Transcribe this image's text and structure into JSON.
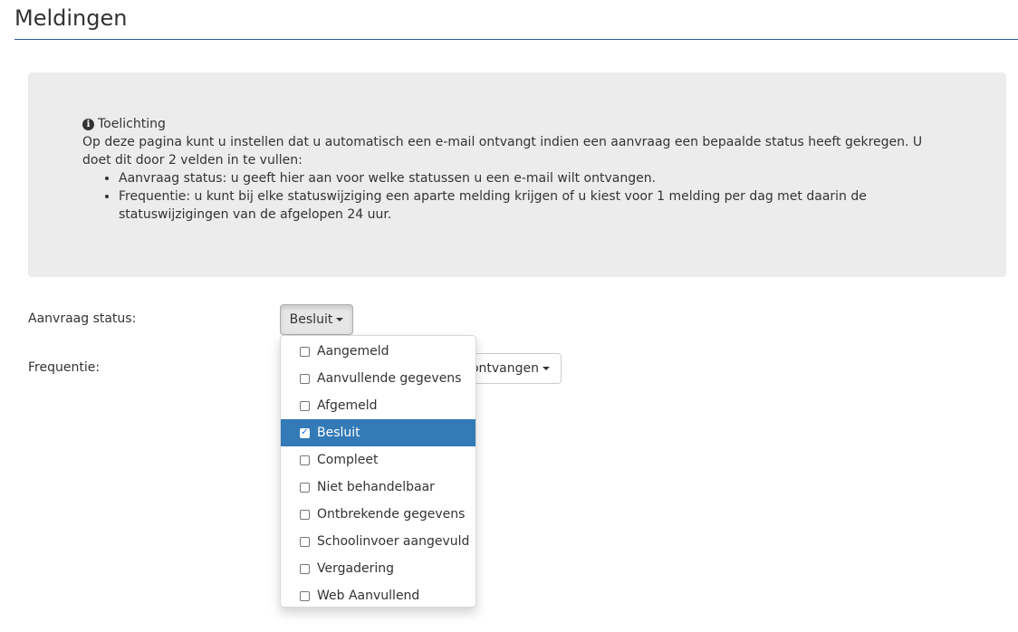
{
  "page": {
    "title": "Meldingen"
  },
  "info": {
    "heading": "Toelichting",
    "text": "Op deze pagina kunt u instellen dat u automatisch een e-mail ontvangt indien een aanvraag een bepaalde status heeft gekregen. U doet dit door 2 velden in te vullen:",
    "items": [
      "Aanvraag status: u geeft hier aan voor welke statussen u een e-mail wilt ontvangen.",
      "Frequentie: u kunt bij elke statuswijziging een aparte melding krijgen of u kiest voor 1 melding per dag met daarin de statuswijzigingen van de afgelopen 24 uur."
    ]
  },
  "form": {
    "status_label": "Aanvraag status:",
    "status_value": "Besluit",
    "frequency_label": "Frequentie:",
    "frequency_value_visible": "ontvangen"
  },
  "dropdown": {
    "options": [
      {
        "label": "Aangemeld",
        "checked": false
      },
      {
        "label": "Aanvullende gegevens",
        "checked": false
      },
      {
        "label": "Afgemeld",
        "checked": false
      },
      {
        "label": "Besluit",
        "checked": true
      },
      {
        "label": "Compleet",
        "checked": false
      },
      {
        "label": "Niet behandelbaar",
        "checked": false
      },
      {
        "label": "Ontbrekende gegevens",
        "checked": false
      },
      {
        "label": "Schoolinvoer aangevuld",
        "checked": false
      },
      {
        "label": "Vergadering",
        "checked": false
      },
      {
        "label": "Web Aanvullend",
        "checked": false
      }
    ]
  },
  "colors": {
    "accent": "#337ab7",
    "header_rule": "#2a5b9e",
    "info_bg": "#ececec"
  }
}
